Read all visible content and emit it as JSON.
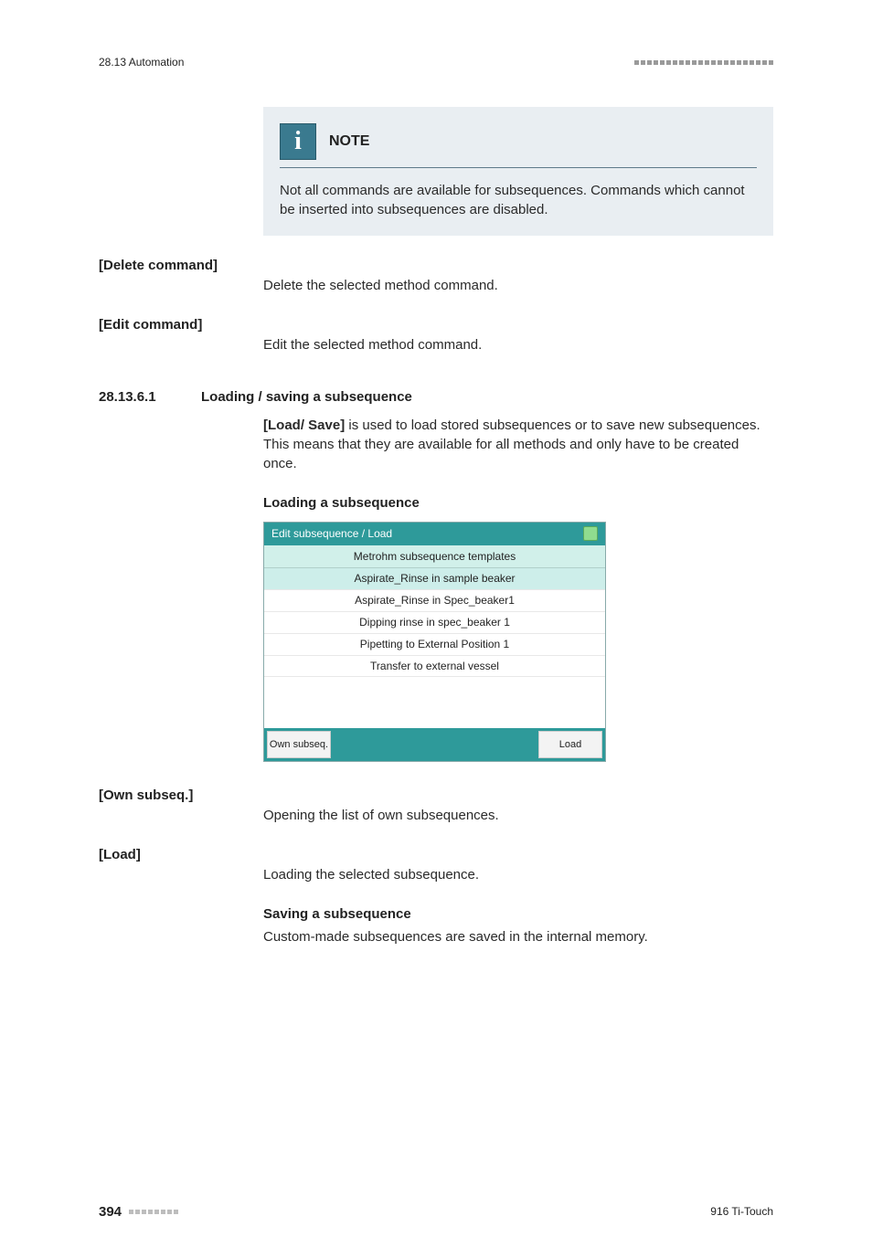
{
  "header": {
    "left": "28.13 Automation"
  },
  "note": {
    "label": "NOTE",
    "body": "Not all commands are available for subsequences. Commands which cannot be inserted into subsequences are disabled."
  },
  "defs": {
    "delete_cmd": {
      "term": "[Delete command]",
      "body": "Delete the selected method command."
    },
    "edit_cmd": {
      "term": "[Edit command]",
      "body": "Edit the selected method command."
    },
    "own_subseq": {
      "term": "[Own subseq.]",
      "body": "Opening the list of own subsequences."
    },
    "load": {
      "term": "[Load]",
      "body": "Loading the selected subsequence."
    }
  },
  "section": {
    "num": "28.13.6.1",
    "title": "Loading / saving a subsequence",
    "lead_strong": "[Load/ Save]",
    "lead_rest": " is used to load stored subsequences or to save new subsequences. This means that they are available for all methods and only have to be created once.",
    "h_load": "Loading a subsequence",
    "h_save": "Saving a subsequence",
    "save_body": "Custom-made subsequences are saved in the internal memory."
  },
  "embed": {
    "title": "Edit subsequence / Load",
    "list_header": "Metrohm subsequence templates",
    "items": [
      "Aspirate_Rinse in sample beaker",
      "Aspirate_Rinse in Spec_beaker1",
      "Dipping rinse in spec_beaker 1",
      "Pipetting to External Position 1",
      "Transfer to external vessel"
    ],
    "btn_left": "Own subseq.",
    "btn_right": "Load"
  },
  "footer": {
    "page": "394",
    "product": "916 Ti-Touch"
  }
}
